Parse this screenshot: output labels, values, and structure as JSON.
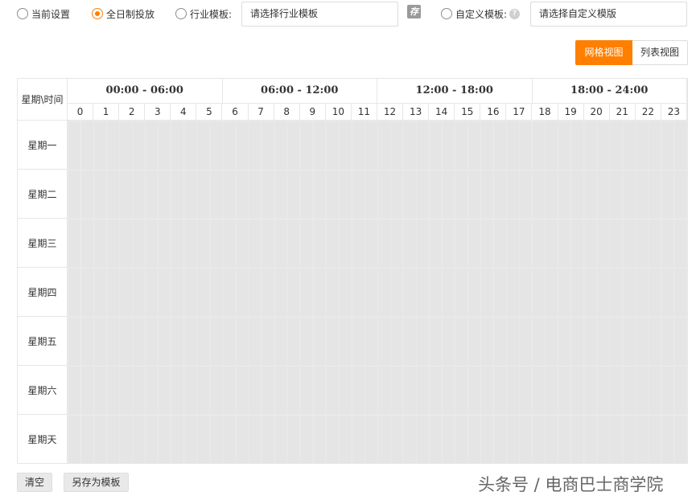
{
  "options": {
    "current_settings": "当前设置",
    "full_day": "全日制投放",
    "industry_template": "行业模板:",
    "industry_placeholder": "请选择行业模板",
    "save_glyph": "存",
    "custom_template": "自定义模板:",
    "help_glyph": "?",
    "custom_placeholder": "请选择自定义模版",
    "selected": "full_day"
  },
  "view": {
    "grid": "网格视图",
    "list": "列表视图",
    "active": "grid"
  },
  "schedule": {
    "corner": "星期\\时间",
    "ranges": [
      "00:00 - 06:00",
      "06:00 - 12:00",
      "12:00 - 18:00",
      "18:00 - 24:00"
    ],
    "hours": [
      "0",
      "1",
      "2",
      "3",
      "4",
      "5",
      "6",
      "7",
      "8",
      "9",
      "10",
      "11",
      "12",
      "13",
      "14",
      "15",
      "16",
      "17",
      "18",
      "19",
      "20",
      "21",
      "22",
      "23"
    ],
    "days": [
      "星期一",
      "星期二",
      "星期三",
      "星期四",
      "星期五",
      "星期六",
      "星期天"
    ]
  },
  "footer": {
    "clear": "清空",
    "save_as_template": "另存为模板"
  },
  "watermark": "头条号 / 电商巴士商学院",
  "colors": {
    "accent": "#ff7f00",
    "cell_fill": "#e5e5e5",
    "border": "#e6e6e6"
  }
}
